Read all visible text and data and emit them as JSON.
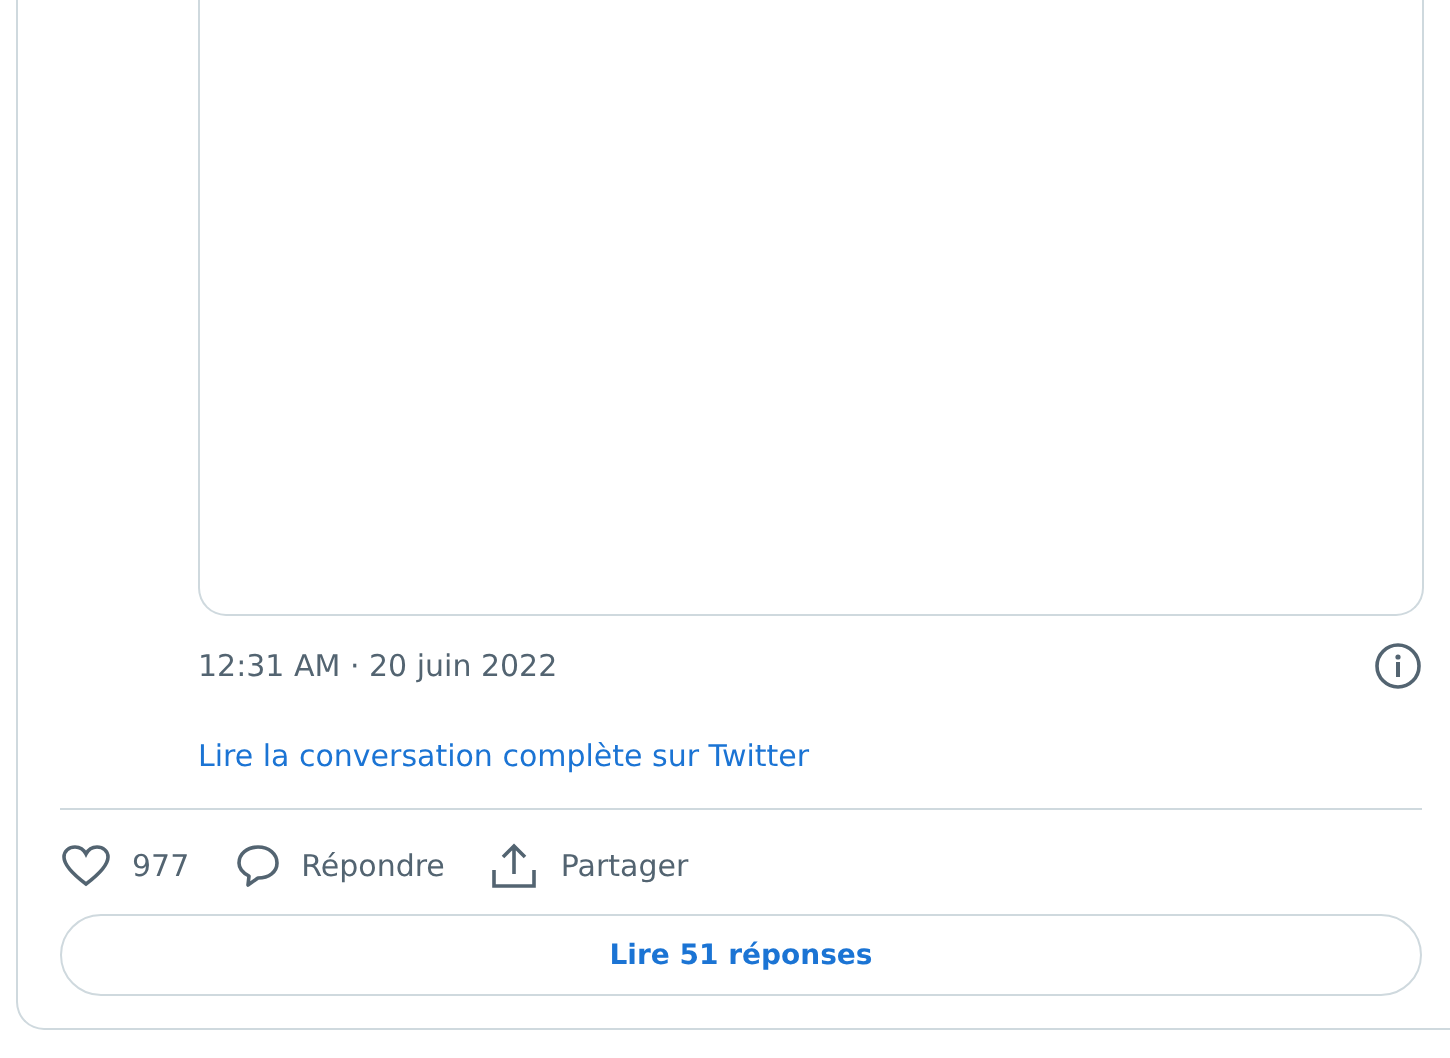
{
  "tweet": {
    "timestamp": "12:31 AM · 20 juin 2022",
    "read_more_link": "Lire la conversation complète sur Twitter"
  },
  "actions": [
    {
      "kind": "like",
      "label": "977"
    },
    {
      "kind": "reply",
      "label": "Répondre"
    },
    {
      "kind": "share",
      "label": "Partager"
    }
  ],
  "replies_button": "Lire 51 réponses"
}
